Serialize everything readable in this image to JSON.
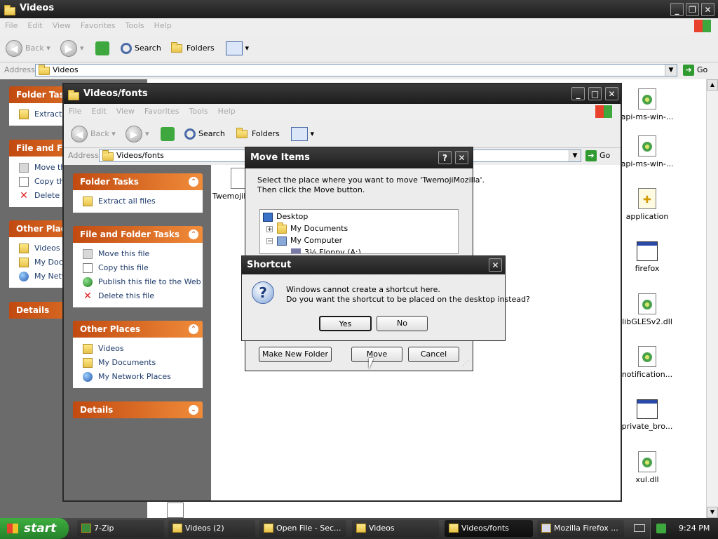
{
  "outer_window": {
    "title": "Videos",
    "menu": [
      "File",
      "Edit",
      "View",
      "Favorites",
      "Tools",
      "Help"
    ],
    "toolbar": {
      "back": "Back",
      "search": "Search",
      "folders": "Folders"
    },
    "address_label": "Address",
    "address_value": "Videos",
    "go_label": "Go",
    "task_panels": [
      {
        "header": "Folder Tasks",
        "items": [
          "Extract all files"
        ]
      },
      {
        "header": "File and Folder Tasks",
        "items": [
          "Move this file",
          "Copy this file",
          "Delete this file"
        ]
      },
      {
        "header": "Other Places",
        "items": [
          "Videos (2)",
          "My Documents",
          "My Network Places"
        ]
      },
      {
        "header": "Details",
        "items": []
      }
    ],
    "desktop_files": [
      "api-ms-win-...",
      "api-ms-win-...",
      "application",
      "firefox",
      "libGLESv2.dll",
      "notification...",
      "private_bro...",
      "xul.dll"
    ]
  },
  "inner_window": {
    "title": "Videos/fonts",
    "menu": [
      "File",
      "Edit",
      "View",
      "Favorites",
      "Tools",
      "Help"
    ],
    "toolbar": {
      "back": "Back",
      "search": "Search",
      "folders": "Folders"
    },
    "address_label": "Address",
    "address_value": "Videos/fonts",
    "go_label": "Go",
    "task_panels": {
      "folder_tasks": {
        "header": "Folder Tasks",
        "items": [
          "Extract all files"
        ]
      },
      "file_folder_tasks": {
        "header": "File and Folder Tasks",
        "items": [
          "Move this file",
          "Copy this file",
          "Publish this file to the Web",
          "Delete this file"
        ]
      },
      "other_places": {
        "header": "Other Places",
        "items": [
          "Videos",
          "My Documents",
          "My Network Places"
        ]
      },
      "details": {
        "header": "Details"
      }
    },
    "file_label": "TwemojiM"
  },
  "move_dialog": {
    "title": "Move Items",
    "help": "?",
    "instruction_line1": "Select the place where you want to move 'TwemojiMozilla'.",
    "instruction_line2": "Then click the Move button.",
    "tree": [
      "Desktop",
      "My Documents",
      "My Computer",
      "3½ Floppy (A:)"
    ],
    "make_new_folder": "Make New Folder",
    "move": "Move",
    "cancel": "Cancel"
  },
  "shortcut_dialog": {
    "title": "Shortcut",
    "message_line1": "Windows cannot create a shortcut here.",
    "message_line2": "Do you want the shortcut to be placed on the desktop instead?",
    "yes": "Yes",
    "no": "No"
  },
  "taskbar": {
    "start": "start",
    "buttons": [
      "7-Zip",
      "Videos (2)",
      "Open File - Sec...",
      "Videos",
      "Videos/fonts",
      "Mozilla Firefox ..."
    ],
    "active_index": 4,
    "clock": "9:24 PM"
  },
  "colors": {
    "orange_header": "#e0661e",
    "title_dark": "#1f1f1f",
    "link_blue": "#1c3a6a"
  }
}
